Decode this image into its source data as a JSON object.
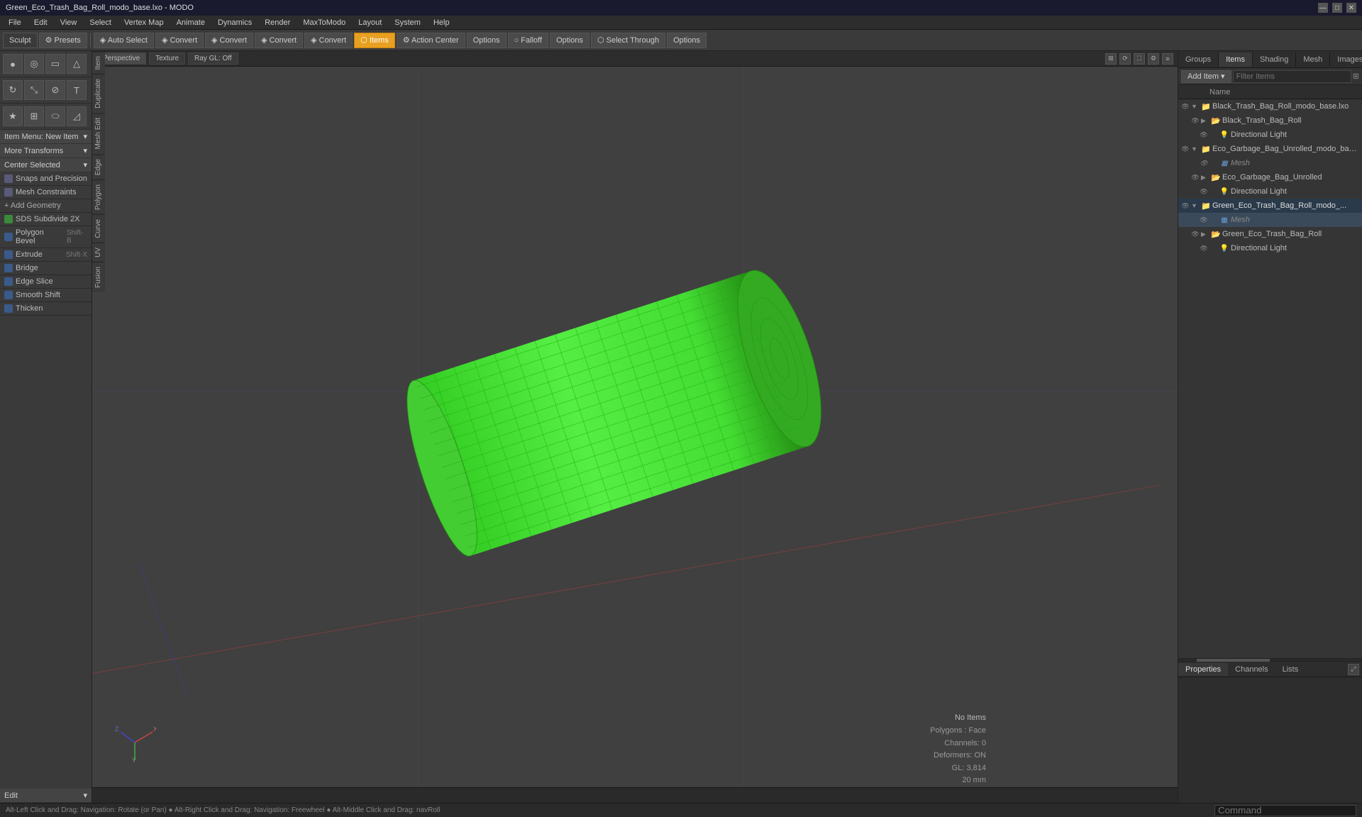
{
  "window": {
    "title": "Green_Eco_Trash_Bag_Roll_modo_base.lxo - MODO"
  },
  "titlebar": {
    "controls": [
      "—",
      "□",
      "✕"
    ]
  },
  "menubar": {
    "items": [
      "File",
      "Edit",
      "View",
      "Select",
      "Vertex Map",
      "Animate",
      "Dynamics",
      "Render",
      "MaxToModo",
      "Layout",
      "System",
      "Help"
    ]
  },
  "toolbar": {
    "sculpt_label": "Sculpt",
    "presets_label": "⚙ Presets",
    "buttons": [
      {
        "label": "◈ Auto Select",
        "active": false
      },
      {
        "label": "◈ Convert",
        "active": false
      },
      {
        "label": "◈ Convert",
        "active": false
      },
      {
        "label": "◈ Convert",
        "active": false
      },
      {
        "label": "◈ Convert",
        "active": false
      },
      {
        "label": "⬡ Items",
        "active": true
      },
      {
        "label": "⚙ Action Center",
        "active": false
      },
      {
        "label": "Options",
        "active": false
      },
      {
        "label": "○ Falloff",
        "active": false
      },
      {
        "label": "Options",
        "active": false
      },
      {
        "label": "⬡ Select Through",
        "active": false
      },
      {
        "label": "Options",
        "active": false
      }
    ]
  },
  "viewport": {
    "tabs": [
      "Perspective",
      "Texture",
      "Ray GL: Off"
    ],
    "mode": "Perspective"
  },
  "left_panel": {
    "top_icons_row1": [
      "circle",
      "torus",
      "box",
      "triangle"
    ],
    "top_icons_row2": [
      "rotate",
      "scale",
      "shear",
      "text"
    ],
    "top_icons_row3": [
      "star",
      "grid",
      "sphere",
      "triangle2"
    ],
    "item_menu_label": "Item Menu: New Item",
    "transforms_label": "More Transforms",
    "center_label": "Center Selected",
    "snaps_label": "Snaps and Precision",
    "mesh_constraints_label": "Mesh Constraints",
    "add_geometry_label": "+ Add Geometry",
    "tools": [
      {
        "label": "SDS Subdivide 2X",
        "icon": "green",
        "shortcut": ""
      },
      {
        "label": "Polygon Bevel",
        "icon": "blue",
        "shortcut": "Shift-B"
      },
      {
        "label": "Extrude",
        "icon": "blue",
        "shortcut": "Shift-X"
      },
      {
        "label": "Bridge",
        "icon": "blue",
        "shortcut": ""
      },
      {
        "label": "Edge Slice",
        "icon": "blue",
        "shortcut": ""
      },
      {
        "label": "Smooth Shift",
        "icon": "blue",
        "shortcut": ""
      },
      {
        "label": "Thicken",
        "icon": "blue",
        "shortcut": ""
      }
    ],
    "edit_label": "Edit",
    "side_tabs": [
      "Item",
      "Duplicate",
      "Mesh Edit",
      "Edge",
      "Polygon",
      "Curve",
      "UV",
      "Fusion"
    ]
  },
  "items_panel": {
    "tab_labels": [
      "Groups",
      "Items",
      "Shading",
      "Mesh",
      "Images"
    ],
    "add_item_label": "Add Item",
    "filter_placeholder": "Filter Items",
    "column_name": "Name",
    "items": [
      {
        "name": "Black_Trash_Bag_Roll_modo_base.lxo",
        "type": "scene",
        "indent": 0,
        "expanded": true,
        "children": [
          {
            "name": "Black_Trash_Bag_Roll",
            "type": "group",
            "indent": 1,
            "expanded": false
          },
          {
            "name": "Directional Light",
            "type": "light",
            "indent": 2
          }
        ]
      },
      {
        "name": "Eco_Garbage_Bag_Unrolled_modo_base.lxo",
        "type": "scene",
        "indent": 0,
        "expanded": true,
        "children": [
          {
            "name": "Mesh",
            "type": "mesh",
            "indent": 2,
            "italic": true
          },
          {
            "name": "Eco_Garbage_Bag_Unrolled",
            "type": "group",
            "indent": 1,
            "expanded": false
          },
          {
            "name": "Directional Light",
            "type": "light",
            "indent": 2
          }
        ]
      },
      {
        "name": "Green_Eco_Trash_Bag_Roll_modo_...",
        "type": "scene",
        "indent": 0,
        "expanded": true,
        "active": true,
        "children": [
          {
            "name": "Mesh",
            "type": "mesh",
            "indent": 2,
            "italic": true
          },
          {
            "name": "Green_Eco_Trash_Bag_Roll",
            "type": "group",
            "indent": 1,
            "expanded": false
          },
          {
            "name": "Directional Light",
            "type": "light",
            "indent": 2
          }
        ]
      }
    ]
  },
  "bottom_panel": {
    "tabs": [
      "Properties",
      "Channels",
      "Lists"
    ],
    "expand_icon": "⤢"
  },
  "info": {
    "no_items": "No Items",
    "polygons": "Polygons : Face",
    "channels": "Channels: 0",
    "deformers": "Deformers: ON",
    "gl": "GL: 3,814",
    "unit": "20 mm"
  },
  "status_bar": {
    "text": "Alt-Left Click and Drag: Navigation: Rotate (or Pan)  ●  Alt-Right Click and Drag: Navigation: Freewheel  ●  Alt-Middle Click and Drag: navRoll",
    "command_placeholder": "Command"
  }
}
